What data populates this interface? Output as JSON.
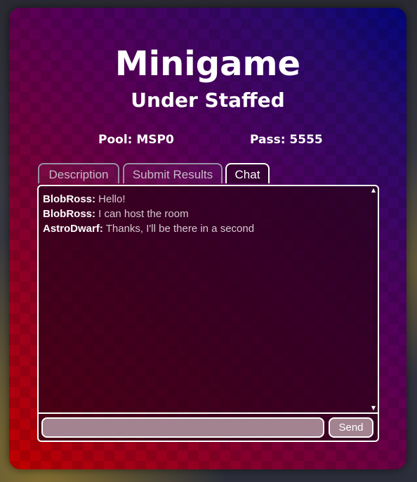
{
  "header": {
    "title": "Minigame",
    "subtitle": "Under Staffed"
  },
  "info": {
    "pool": "Pool: MSP0",
    "pass": "Pass: 5555"
  },
  "tabs": [
    {
      "label": "Description",
      "active": false
    },
    {
      "label": "Submit Results",
      "active": false
    },
    {
      "label": "Chat",
      "active": true
    }
  ],
  "chat": {
    "messages": [
      {
        "author": "BlobRoss:",
        "text": " Hello!"
      },
      {
        "author": "BlobRoss:",
        "text": " I can host the room"
      },
      {
        "author": "AstroDwarf:",
        "text": " Thanks, I'll be there in a second"
      }
    ],
    "input_value": "",
    "send_label": "Send"
  },
  "colors": {
    "panel_gradient_start": "#c10000",
    "panel_gradient_end": "#03067a",
    "input_fill": "#a2838f",
    "text": "#ffffff"
  }
}
